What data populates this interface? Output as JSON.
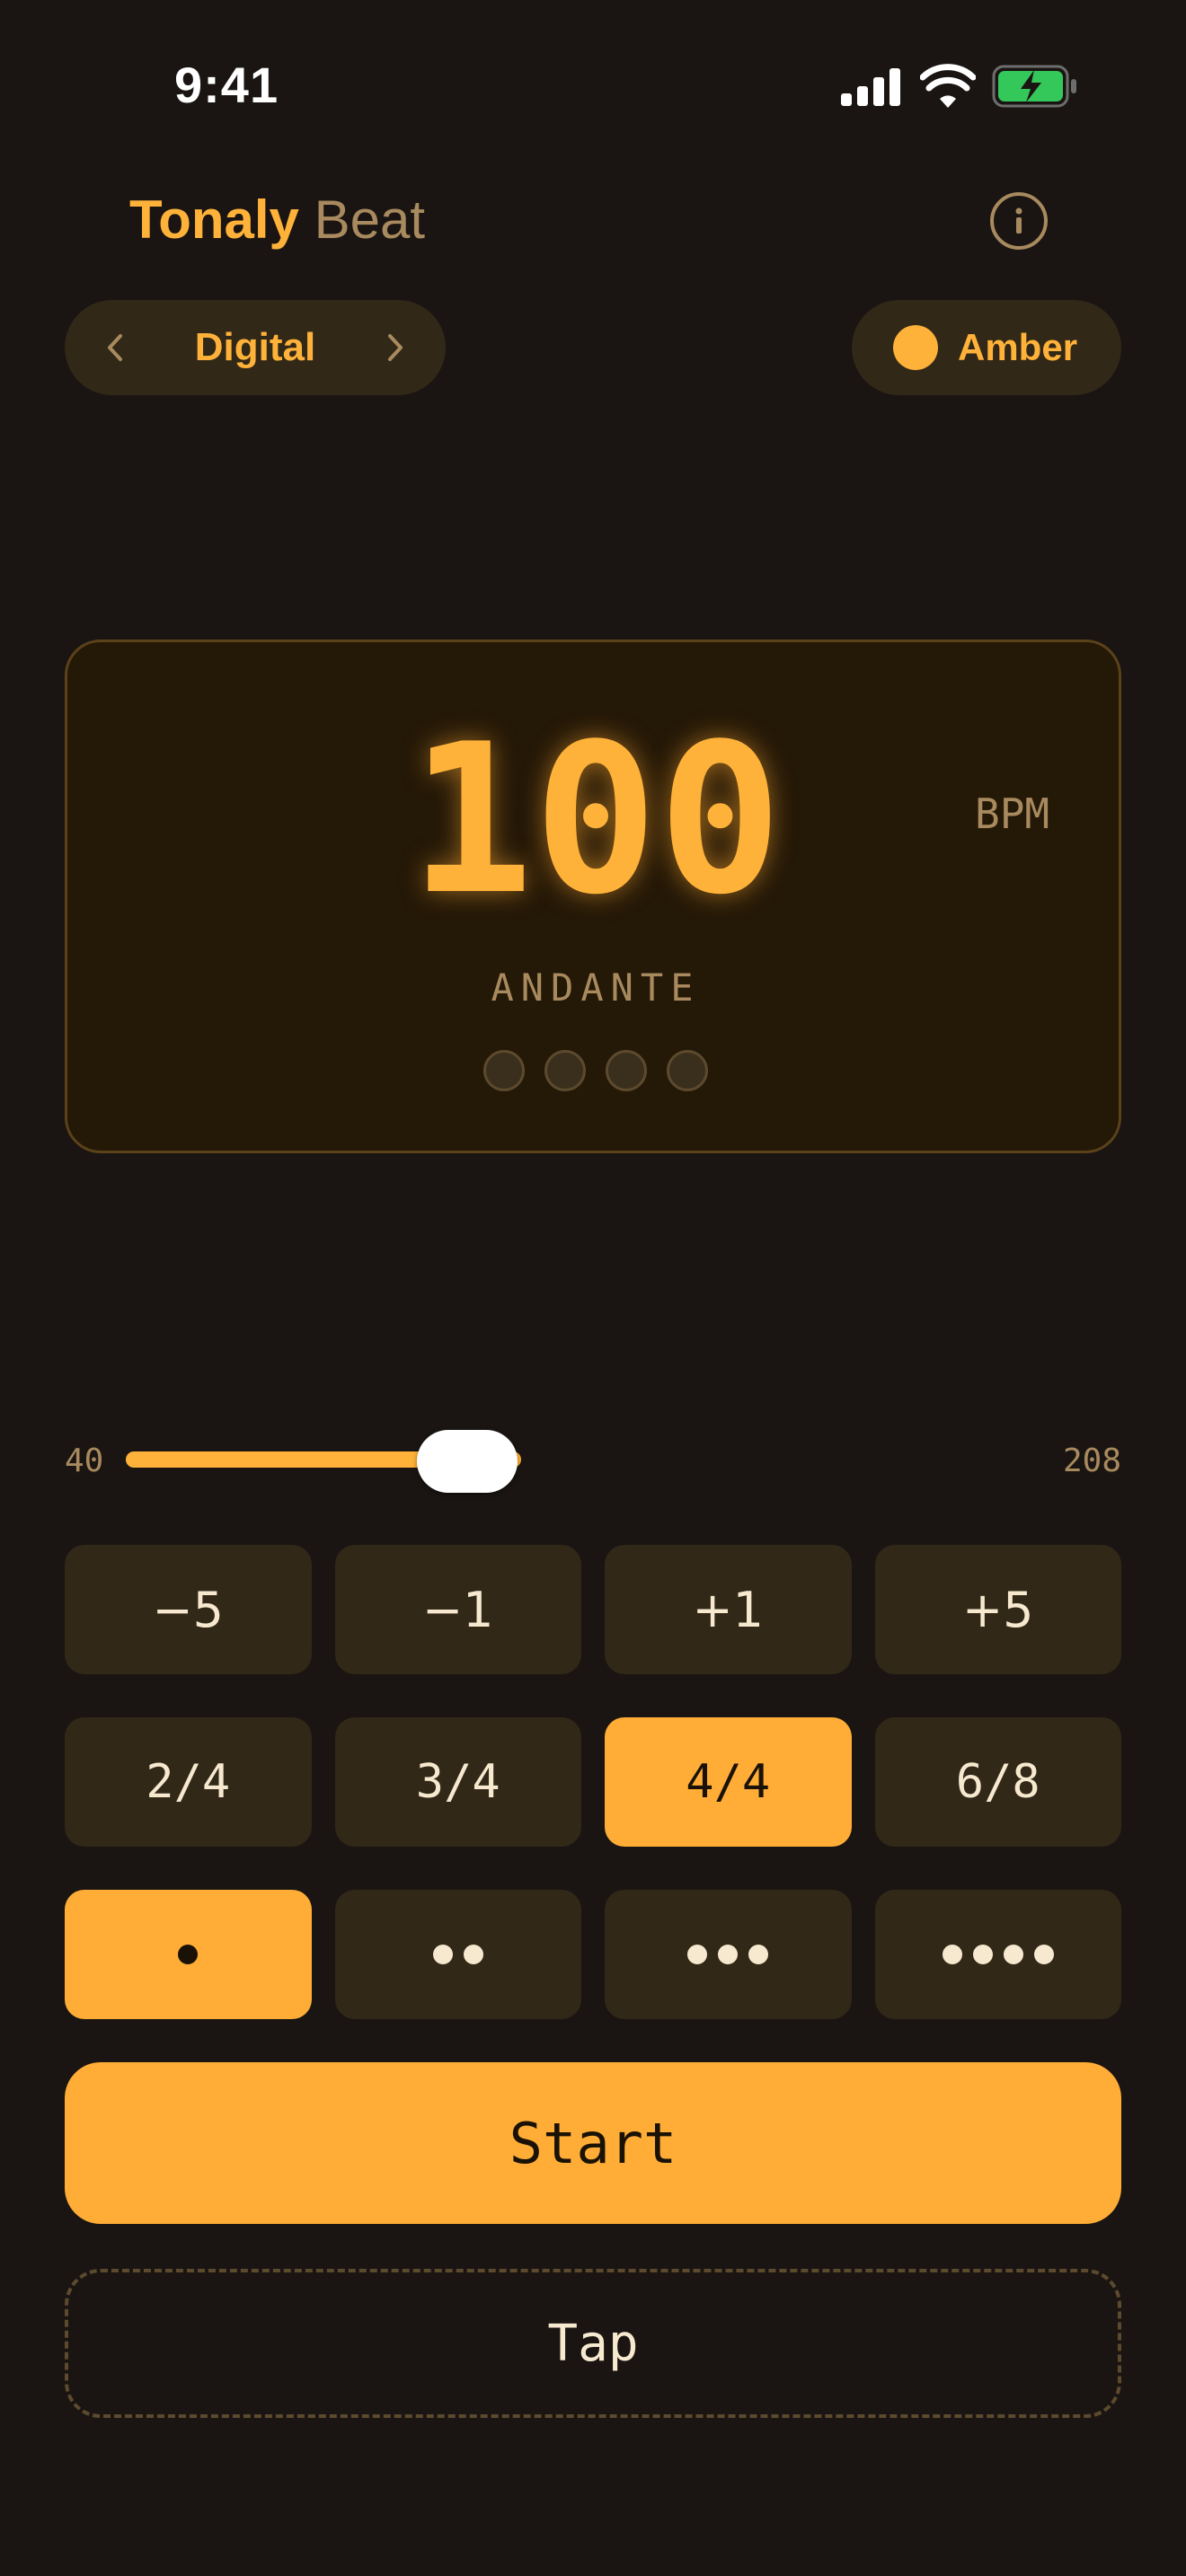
{
  "status_bar": {
    "time": "9:41"
  },
  "header": {
    "brand": "Tonaly",
    "subtitle": "Beat"
  },
  "style_selector": {
    "label": "Digital"
  },
  "theme_selector": {
    "label": "Amber",
    "color": "#ffb239"
  },
  "display": {
    "bpm": "100",
    "unit": "BPM",
    "tempo_name": "ANDANTE",
    "beats": 4
  },
  "slider": {
    "min": "40",
    "max": "208",
    "value": 100
  },
  "adjust_buttons": [
    "−5",
    "−1",
    "+1",
    "+5"
  ],
  "meter_buttons": [
    {
      "label": "2/4",
      "active": false
    },
    {
      "label": "3/4",
      "active": false
    },
    {
      "label": "4/4",
      "active": true
    },
    {
      "label": "6/8",
      "active": false
    }
  ],
  "subdivision_buttons": [
    {
      "dots": 1,
      "active": true
    },
    {
      "dots": 2,
      "active": false
    },
    {
      "dots": 3,
      "active": false
    },
    {
      "dots": 4,
      "active": false
    }
  ],
  "actions": {
    "start": "Start",
    "tap": "Tap"
  },
  "colors": {
    "accent": "#ffad36",
    "background": "#1a1512",
    "surface": "#312818",
    "muted": "#a88a5e"
  }
}
